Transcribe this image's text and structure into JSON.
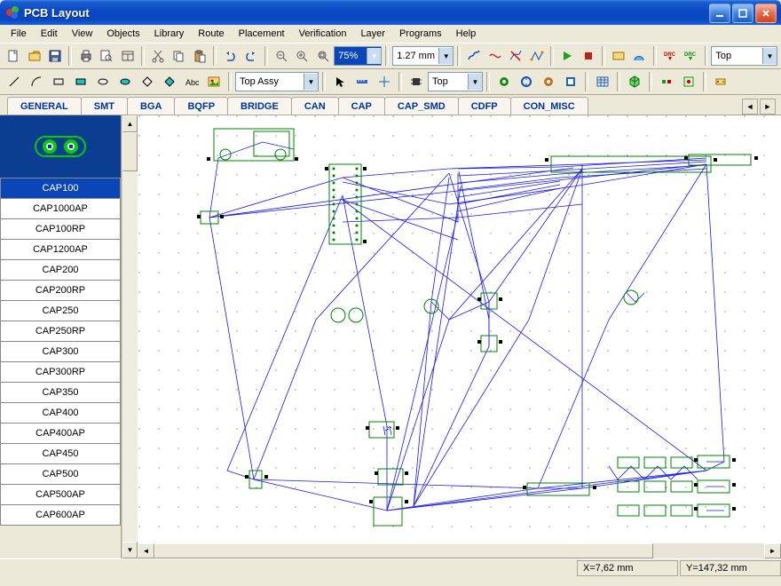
{
  "window": {
    "title": "PCB Layout"
  },
  "menu": [
    "File",
    "Edit",
    "View",
    "Objects",
    "Library",
    "Route",
    "Placement",
    "Verification",
    "Layer",
    "Programs",
    "Help"
  ],
  "tb1": {
    "zoom": "75%",
    "grid": "1.27 mm",
    "layer": "Top"
  },
  "tb2": {
    "assy": "Top Assy",
    "layer2": "Top"
  },
  "cats": [
    "GENERAL",
    "SMT",
    "BGA",
    "BQFP",
    "BRIDGE",
    "CAN",
    "CAP",
    "CAP_SMD",
    "CDFP",
    "CON_MISC"
  ],
  "components": {
    "selected": "CAP100",
    "items": [
      "CAP100",
      "CAP1000AP",
      "CAP100RP",
      "CAP1200AP",
      "CAP200",
      "CAP200RP",
      "CAP250",
      "CAP250RP",
      "CAP300",
      "CAP300RP",
      "CAP350",
      "CAP400",
      "CAP400AP",
      "CAP450",
      "CAP500",
      "CAP500AP",
      "CAP600AP"
    ]
  },
  "status": {
    "x": "X=7,62 mm",
    "y": "Y=147,32 mm"
  }
}
